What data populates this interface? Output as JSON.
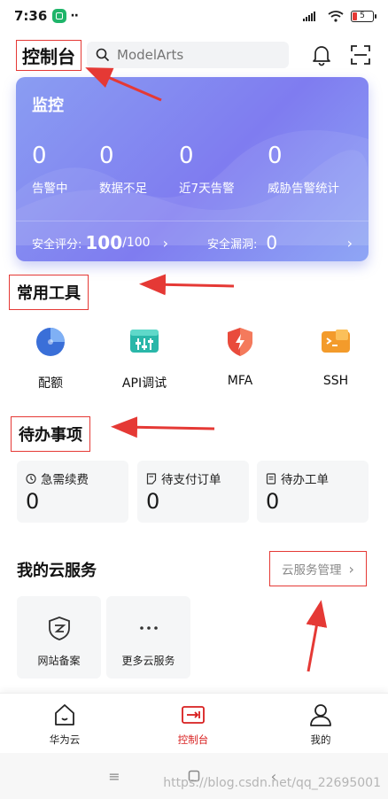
{
  "status": {
    "time": "7:36",
    "dots": "··",
    "battery": "5"
  },
  "header": {
    "title": "控制台",
    "search_placeholder": "ModelArts"
  },
  "monitor": {
    "title": "监控",
    "stats": [
      {
        "value": "0",
        "label": "告警中"
      },
      {
        "value": "0",
        "label": "数据不足"
      },
      {
        "value": "0",
        "label": "近7天告警"
      },
      {
        "value": "0",
        "label": "威胁告警统计"
      }
    ],
    "score_label": "安全评分:",
    "score_value": "100",
    "score_max": "/100",
    "vuln_label": "安全漏洞:",
    "vuln_value": "0"
  },
  "tools": {
    "title": "常用工具",
    "items": [
      {
        "label": "配额",
        "icon": "quota-icon"
      },
      {
        "label": "API调试",
        "icon": "api-debug-icon"
      },
      {
        "label": "MFA",
        "icon": "mfa-icon"
      },
      {
        "label": "SSH",
        "icon": "ssh-icon"
      }
    ]
  },
  "todo": {
    "title": "待办事项",
    "items": [
      {
        "label": "急需续费",
        "count": "0",
        "icon": "clock-icon"
      },
      {
        "label": "待支付订单",
        "count": "0",
        "icon": "order-icon"
      },
      {
        "label": "待办工单",
        "count": "0",
        "icon": "ticket-icon"
      }
    ]
  },
  "services": {
    "title": "我的云服务",
    "manage_label": "云服务管理",
    "items": [
      {
        "label": "网站备案",
        "icon": "website-filing-icon"
      },
      {
        "label": "更多云服务",
        "icon": "more-icon"
      }
    ]
  },
  "tabbar": {
    "items": [
      {
        "label": "华为云",
        "icon": "home-icon"
      },
      {
        "label": "控制台",
        "icon": "console-icon"
      },
      {
        "label": "我的",
        "icon": "user-icon"
      }
    ],
    "active_color": "#d81e1e"
  },
  "watermark": "https://blog.csdn.net/qq_22695001",
  "colors": {
    "accent": "#d81e1e",
    "card_gradient_start": "#8a9df2",
    "card_gradient_end": "#7f7cf0",
    "annotation": "#e53935"
  }
}
